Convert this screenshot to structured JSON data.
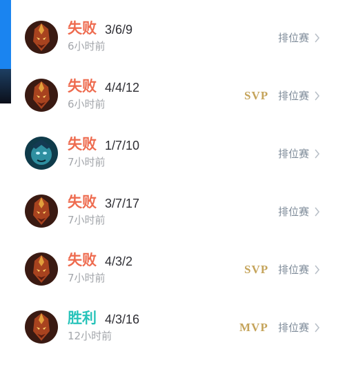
{
  "matches": [
    {
      "result": "失败",
      "outcome": "loss",
      "kda": "3/6/9",
      "time": "6小时前",
      "badge": "",
      "mode": "排位赛",
      "hero_icon": "armored-hero-avatar-icon"
    },
    {
      "result": "失败",
      "outcome": "loss",
      "kda": "4/4/12",
      "time": "6小时前",
      "badge": "SVP",
      "mode": "排位赛",
      "hero_icon": "armored-hero-avatar-icon"
    },
    {
      "result": "失败",
      "outcome": "loss",
      "kda": "1/7/10",
      "time": "7小时前",
      "badge": "",
      "mode": "排位赛",
      "hero_icon": "blue-hero-avatar-icon"
    },
    {
      "result": "失败",
      "outcome": "loss",
      "kda": "3/7/17",
      "time": "7小时前",
      "badge": "",
      "mode": "排位赛",
      "hero_icon": "armored-hero-avatar-icon"
    },
    {
      "result": "失败",
      "outcome": "loss",
      "kda": "4/3/2",
      "time": "7小时前",
      "badge": "SVP",
      "mode": "排位赛",
      "hero_icon": "armored-hero-avatar-icon"
    },
    {
      "result": "胜利",
      "outcome": "win",
      "kda": "4/3/16",
      "time": "12小时前",
      "badge": "MVP",
      "mode": "排位赛",
      "hero_icon": "armored-hero-avatar-icon"
    }
  ],
  "colors": {
    "loss": "#ee6b4f",
    "win": "#28c3ba",
    "badge_gold": "#c5a45b",
    "accent": "#1a84f0",
    "muted": "#a3a6ab"
  }
}
